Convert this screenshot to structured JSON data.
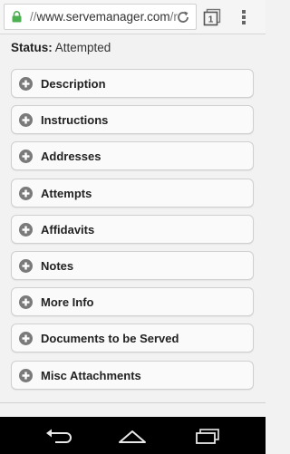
{
  "browser": {
    "url_prefix": "//",
    "url_host": "www.servemanager.com",
    "url_suffix": "/r",
    "icons": {
      "lock": "lock-icon",
      "reload": "reload-icon",
      "tabs": "tabs-icon",
      "menu": "overflow-menu-icon"
    },
    "tab_count": "1",
    "secure_color": "#4caf50"
  },
  "page": {
    "status_label": "Status:",
    "status_value": "Attempted",
    "sections": [
      {
        "label": "Description"
      },
      {
        "label": "Instructions"
      },
      {
        "label": "Addresses"
      },
      {
        "label": "Attempts"
      },
      {
        "label": "Affidavits"
      },
      {
        "label": "Notes"
      },
      {
        "label": "More Info"
      },
      {
        "label": "Documents to be Served"
      },
      {
        "label": "Misc Attachments"
      }
    ],
    "section_icon": "plus-circle-icon"
  },
  "navbar": {
    "icons": [
      "back-icon",
      "home-icon",
      "recents-icon"
    ]
  }
}
